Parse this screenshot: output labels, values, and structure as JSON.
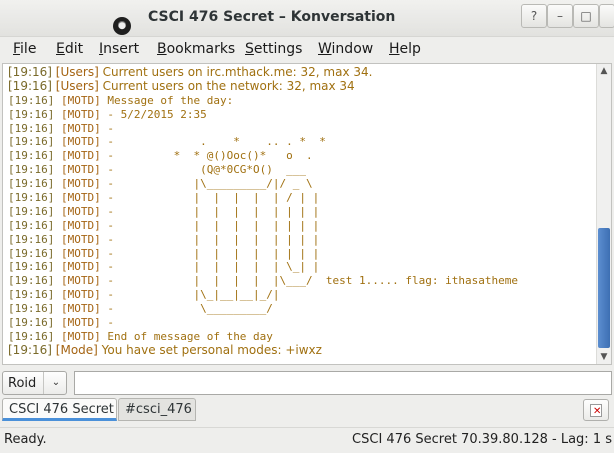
{
  "window": {
    "title": "CSCI 476 Secret – Konversation",
    "controls": {
      "help": "?",
      "minimize": "–",
      "maximize": "□",
      "close": "✕"
    }
  },
  "menubar": [
    {
      "label": "File",
      "mnemonic": "F",
      "rest": "ile"
    },
    {
      "label": "Edit",
      "mnemonic": "E",
      "rest": "dit"
    },
    {
      "label": "Insert",
      "mnemonic": "I",
      "rest": "nsert"
    },
    {
      "label": "Bookmarks",
      "mnemonic": "B",
      "rest": "ookmarks"
    },
    {
      "label": "Settings",
      "mnemonic": "S",
      "rest": "ettings"
    },
    {
      "label": "Window",
      "mnemonic": "W",
      "rest": "indow"
    },
    {
      "label": "Help",
      "mnemonic": "H",
      "rest": "elp"
    }
  ],
  "chat": {
    "lines": [
      {
        "ts": "[19:16]",
        "tag": "[Users]",
        "msg": "Current users on irc.mthack.me: 32, max 34.",
        "prop": true
      },
      {
        "ts": "[19:16]",
        "tag": "[Users]",
        "msg": "Current users on the network: 32, max 34",
        "prop": true
      },
      {
        "ts": "[19:16]",
        "tag": "[MOTD]",
        "msg": "Message of the day:"
      },
      {
        "ts": "[19:16]",
        "tag": "[MOTD]",
        "msg": "- 5/2/2015 2:35"
      },
      {
        "ts": "[19:16]",
        "tag": "[MOTD]",
        "msg": "-"
      },
      {
        "ts": "[19:16]",
        "tag": "[MOTD]",
        "msg": "-             .    *    .. . *  *"
      },
      {
        "ts": "[19:16]",
        "tag": "[MOTD]",
        "msg": "-         *  * @()Ooc()*   o  ."
      },
      {
        "ts": "[19:16]",
        "tag": "[MOTD]",
        "msg": "-             (Q@*0CG*O()  ___"
      },
      {
        "ts": "[19:16]",
        "tag": "[MOTD]",
        "msg": "-            |\\_________/|/ _ \\"
      },
      {
        "ts": "[19:16]",
        "tag": "[MOTD]",
        "msg": "-            |  |  |  |  | / | |"
      },
      {
        "ts": "[19:16]",
        "tag": "[MOTD]",
        "msg": "-            |  |  |  |  | | | |"
      },
      {
        "ts": "[19:16]",
        "tag": "[MOTD]",
        "msg": "-            |  |  |  |  | | | |"
      },
      {
        "ts": "[19:16]",
        "tag": "[MOTD]",
        "msg": "-            |  |  |  |  | | | |"
      },
      {
        "ts": "[19:16]",
        "tag": "[MOTD]",
        "msg": "-            |  |  |  |  | | | |"
      },
      {
        "ts": "[19:16]",
        "tag": "[MOTD]",
        "msg": "-            |  |  |  |  | \\_| |"
      },
      {
        "ts": "[19:16]",
        "tag": "[MOTD]",
        "msg": "-            |  |  |  |  |\\___/  test 1..... flag: ithasatheme"
      },
      {
        "ts": "[19:16]",
        "tag": "[MOTD]",
        "msg": "-            |\\_|__|__|_/|"
      },
      {
        "ts": "[19:16]",
        "tag": "[MOTD]",
        "msg": "-             \\_________/"
      },
      {
        "ts": "[19:16]",
        "tag": "[MOTD]",
        "msg": "-"
      },
      {
        "ts": "[19:16]",
        "tag": "[MOTD]",
        "msg": "End of message of the day"
      },
      {
        "ts": "[19:16]",
        "tag": "[Mode]",
        "msg": "You have set personal modes: +iwxz",
        "prop": true
      }
    ]
  },
  "input": {
    "nick": "Roid",
    "nick_arrow": "⌄",
    "value": ""
  },
  "tabs": [
    {
      "label": "CSCI 476 Secret",
      "active": true
    },
    {
      "label": "#csci_476",
      "active": false
    }
  ],
  "status": {
    "left": "Ready.",
    "right": "CSCI 476 Secret  70.39.80.128 - Lag: 1 s"
  },
  "colors": {
    "accent": "#4a90d9",
    "chat_text": "#a07010",
    "scroll_thumb": "#4a7fc4"
  }
}
